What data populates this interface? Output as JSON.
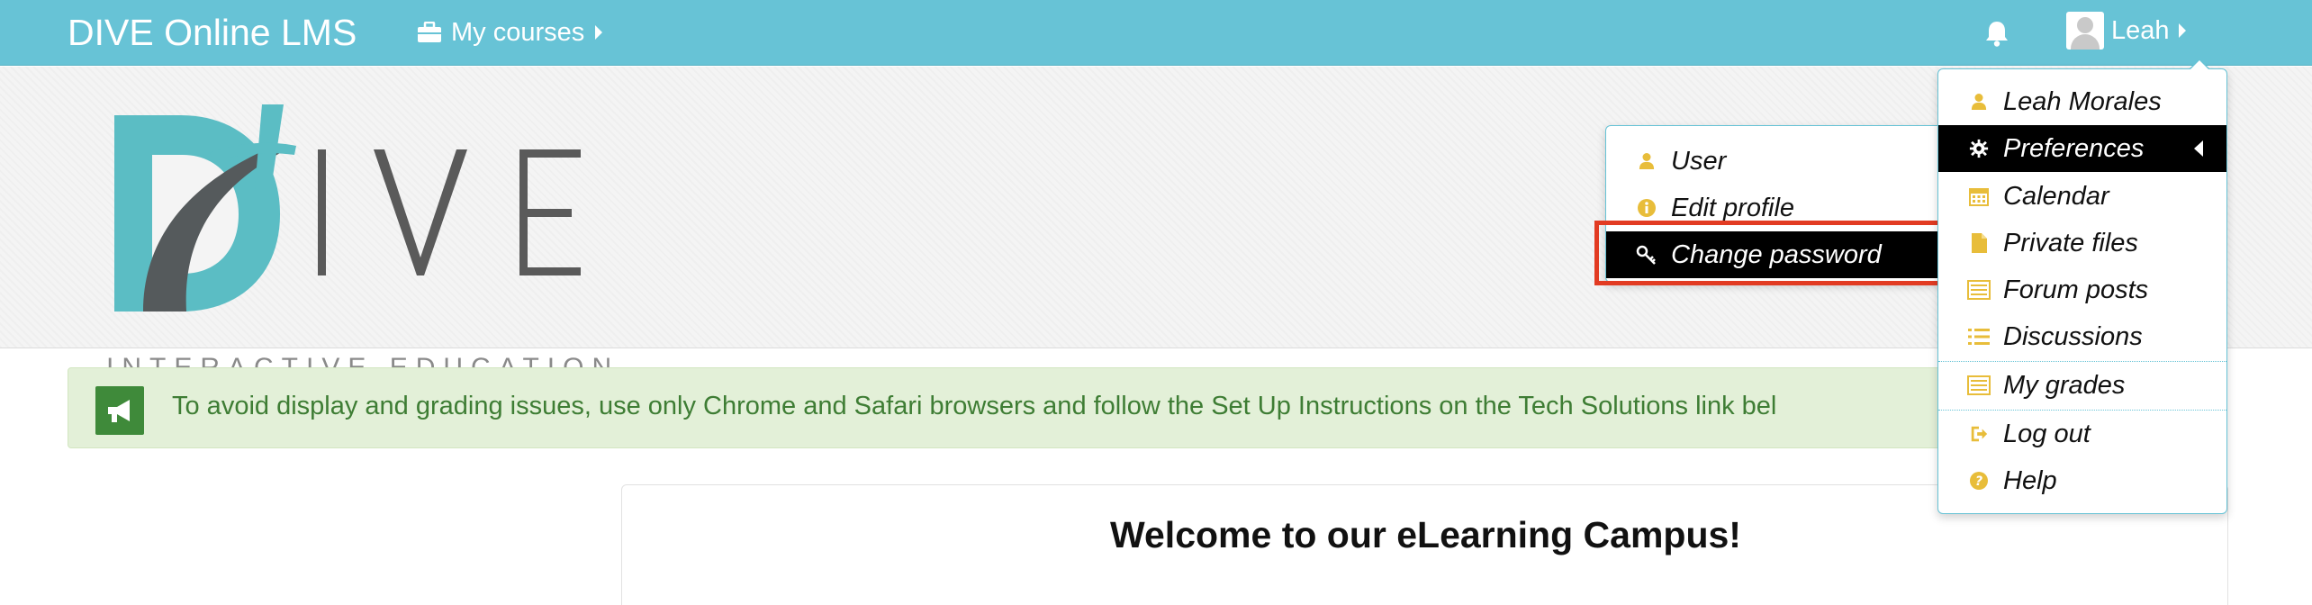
{
  "navbar": {
    "brand": "DIVE Online LMS",
    "my_courses": "My courses",
    "user_name": "Leah"
  },
  "logo": {
    "letters": "I V E",
    "tagline": "INTERACTIVE EDUCATION"
  },
  "alert": {
    "text": "To avoid display and grading issues, use only Chrome and Safari browsers and follow the Set Up Instructions on the Tech Solutions link bel"
  },
  "main": {
    "welcome_title": "Welcome to our eLearning Campus!"
  },
  "user_menu": {
    "items": [
      {
        "label": "Leah Morales",
        "icon": "user-icon"
      },
      {
        "label": "Preferences",
        "icon": "gear-icon"
      },
      {
        "label": "Calendar",
        "icon": "calendar-icon"
      },
      {
        "label": "Private files",
        "icon": "file-icon"
      },
      {
        "label": "Forum posts",
        "icon": "list-alt-icon"
      },
      {
        "label": "Discussions",
        "icon": "list-icon"
      },
      {
        "label": "My grades",
        "icon": "table-icon"
      },
      {
        "label": "Log out",
        "icon": "sign-out-icon"
      },
      {
        "label": "Help",
        "icon": "question-circle-icon"
      }
    ]
  },
  "preferences_menu": {
    "items": [
      {
        "label": "User",
        "icon": "user-icon"
      },
      {
        "label": "Edit profile",
        "icon": "info-circle-icon"
      },
      {
        "label": "Change password",
        "icon": "key-icon"
      }
    ]
  },
  "colors": {
    "navbar": "#67c3d6",
    "icon_yellow": "#e8bd3a",
    "alert_bg": "#e3f0d8",
    "alert_text": "#3e7d34",
    "highlight": "#e23b22"
  }
}
